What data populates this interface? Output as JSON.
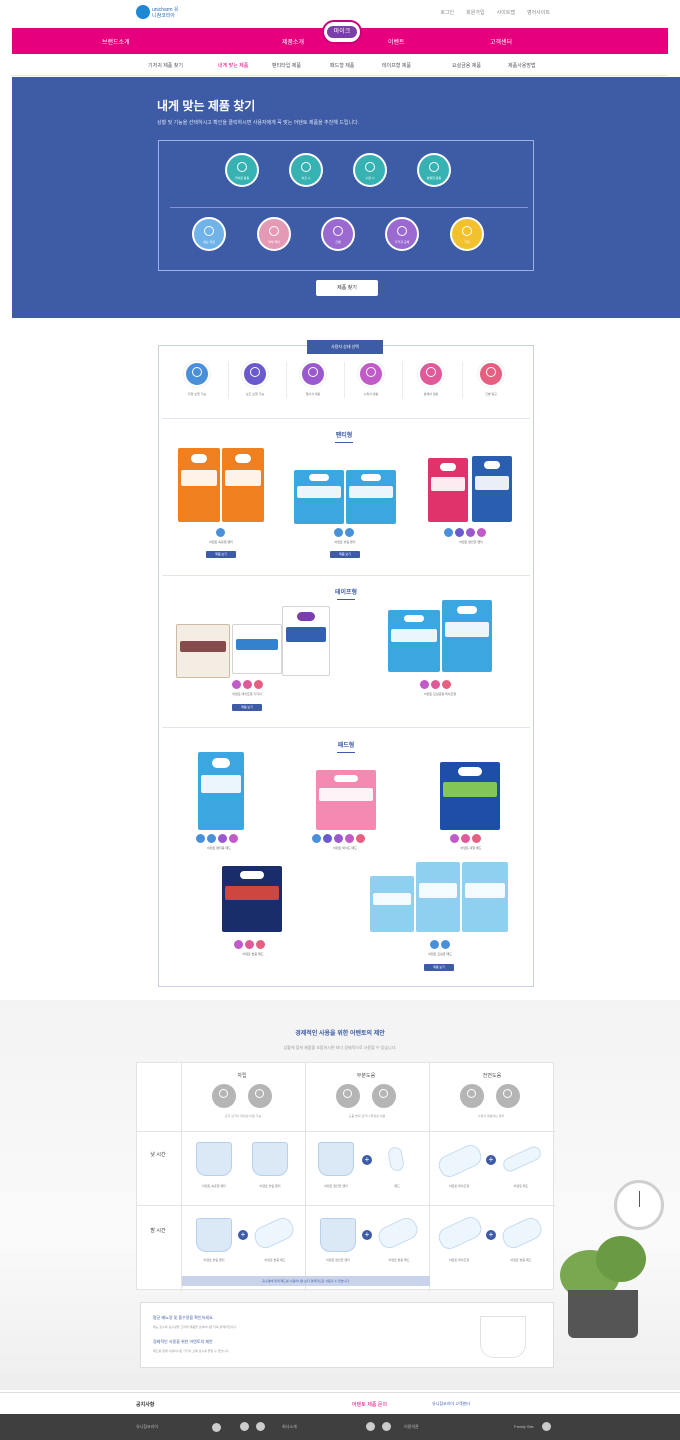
{
  "header": {
    "logo_text": "unicharm 유니참코리아",
    "top_links": [
      "로그인",
      "회원가입",
      "사이트맵",
      "영어사이트"
    ],
    "brand": "마이크"
  },
  "gnb": [
    "브랜드소개",
    "제품소개",
    "이벤트",
    "고객센터"
  ],
  "subnav": [
    "기저귀 제품 찾기",
    "내게 맞는 제품",
    "팬티타입 제품",
    "패드형 제품",
    "테이프형 제품",
    "요실금용 제품",
    "제품사용방법"
  ],
  "hero": {
    "title": "내게 맞는 제품 찾기",
    "desc": "상황 및 기능을 선택하시고 확인을 클릭하시면 사용자에게 꼭 맞는 어텐토 제품을 추천해 드립니다.",
    "icons_row1": [
      "가벼운 활동",
      "외출 시",
      "수면 시",
      "활발한 활동"
    ],
    "icons_row2": [
      "새는 걱정",
      "피부 케어",
      "간병",
      "기저귀 교체",
      "기타"
    ],
    "button": "제품 찾기"
  },
  "panel": {
    "tab": "사용자 상태 선택",
    "icons": [
      {
        "label": "자립 보행 가능",
        "color": "#4a90d9"
      },
      {
        "label": "보조 보행 가능",
        "color": "#6a5acd"
      },
      {
        "label": "앉아서 생활",
        "color": "#9b59d0"
      },
      {
        "label": "누워서 생활",
        "color": "#c05bc7"
      },
      {
        "label": "휠체어 생활",
        "color": "#e05a9a"
      },
      {
        "label": "간병 필요",
        "color": "#e56080"
      }
    ],
    "sections": [
      {
        "title": "팬티형",
        "items": [
          {
            "name": "어텐토 속옷형 팬티",
            "btn": "제품 보기"
          },
          {
            "name": "어텐토 슬림 팬티",
            "btn": "제품 보기"
          },
          {
            "name": "어텐토 편안한 팬티",
            "btn": ""
          }
        ]
      },
      {
        "title": "테이프형",
        "items": [
          {
            "name": "어텐토 테이프형 기저귀",
            "btn": "제품 보기"
          },
          {
            "name": "어텐토 요실금용 테이프형",
            "btn": ""
          }
        ]
      },
      {
        "title": "패드형",
        "items": [
          {
            "name": "어텐토 팬티용 패드",
            "btn": ""
          },
          {
            "name": "어텐토 와이드 패드",
            "btn": ""
          },
          {
            "name": "어텐토 대형 패드",
            "btn": ""
          },
          {
            "name": "어텐토 밤용 패드",
            "btn": ""
          },
          {
            "name": "어텐토 요실금 패드",
            "btn": "제품 보기"
          }
        ]
      }
    ]
  },
  "eco": {
    "title": "경제적인 사용을 위한 어텐토의 제안",
    "subtitle": "상황에 맞게 제품을 조합하시면 보다 경제적으로 사용할 수 있습니다.",
    "cols": [
      {
        "head": "자립",
        "note": "혼자 걷거나 화장실 이용 가능"
      },
      {
        "head": "부분도움",
        "note": "도움 받아 걷거나 화장실 이용"
      },
      {
        "head": "전면도움",
        "note": "누워서 생활하는 경우"
      }
    ],
    "rows": [
      {
        "label": "낮 시간"
      },
      {
        "label": "밤 시간"
      }
    ],
    "items_day": [
      "어텐토 속옷형 팬티",
      "어텐토 슬림 팬티",
      "어텐토 편안한 팬티",
      "패드",
      "어텐토 테이프형",
      "어텐토 패드"
    ],
    "items_night": [
      "어텐토 슬림 팬티",
      "어텐토 밤용 패드",
      "어텐토 편안한 팬티",
      "어텐토 밤용 패드",
      "어텐토 테이프형",
      "어텐토 밤용 패드"
    ],
    "bar": "흡수량에 맞게 패드를 사용하시면 보다 경제적으로 사용할 수 있습니다.",
    "note_title1": "평균 배뇨량 및 흡수량을 확인하세요.",
    "note_sub1": "배뇨 횟수와 흡수량을 고려해 제품을 선택하시면 더욱 경제적입니다.",
    "note_title2": "경제적인 사용을 위한 어텐토의 제안",
    "note_sub2": "패드를 함께 사용하시면 기저귀 교체 횟수를 줄일 수 있습니다."
  },
  "footer": {
    "links": [
      "회사소개",
      "이용약관",
      "개인정보처리방침",
      "사이트맵"
    ],
    "label": "공지사항",
    "highlight": "어텐토 제품 문의",
    "right": "유니참코리아 고객센터",
    "company": "유니참코리아",
    "family": "Family Site"
  },
  "colors": {
    "magenta": "#e6007e",
    "navy": "#3e5ca6"
  }
}
